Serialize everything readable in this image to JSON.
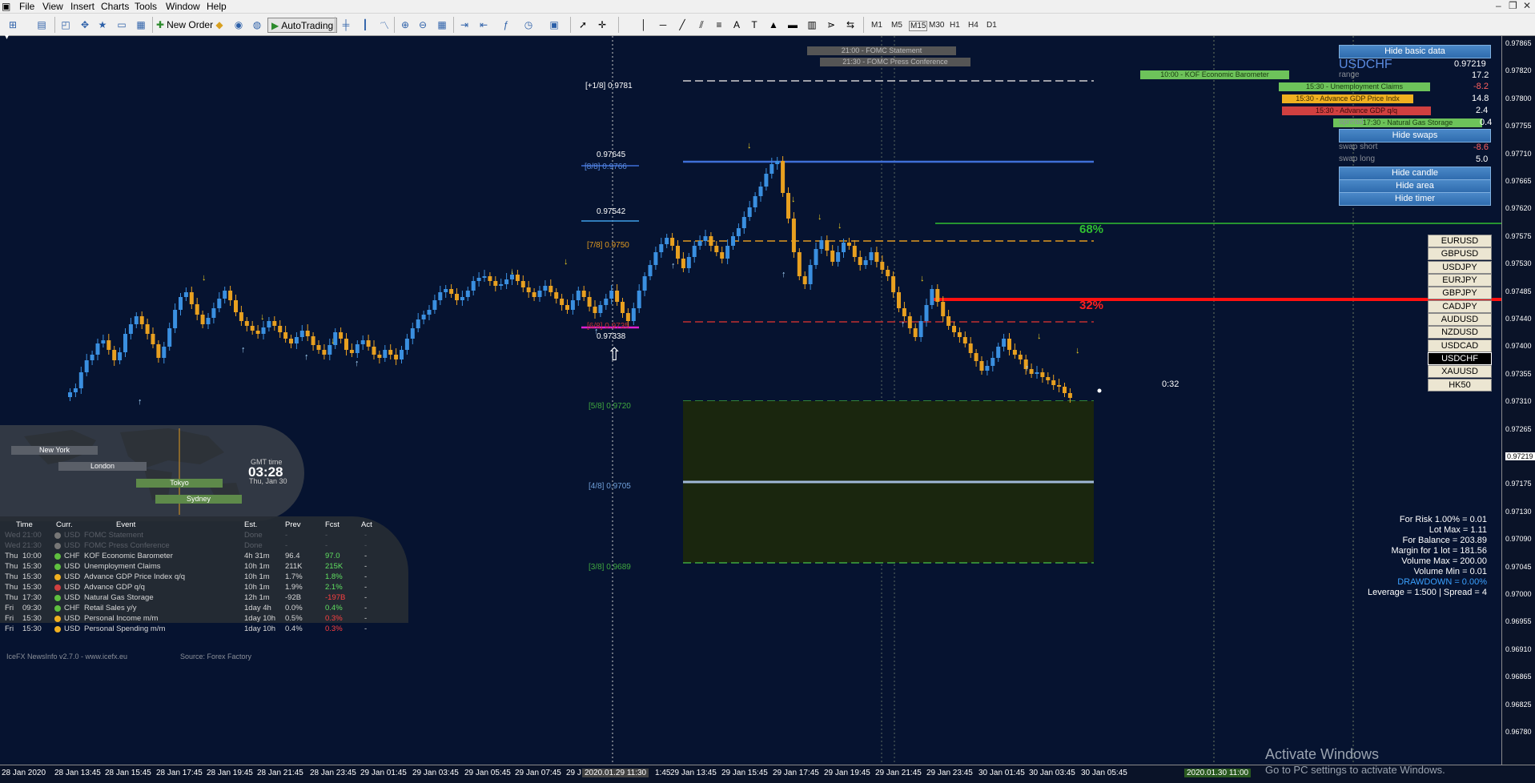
{
  "menu": {
    "items": [
      "File",
      "View",
      "Insert",
      "Charts",
      "Tools",
      "Window",
      "Help"
    ]
  },
  "toolbar": {
    "new_order": "New Order",
    "autotrading": "AutoTrading",
    "timeframes": [
      "M1",
      "M5",
      "M15",
      "M30",
      "H1",
      "H4",
      "D1"
    ]
  },
  "chart": {
    "symbol": "USDCHF",
    "price": "0.97219",
    "range_label": "range",
    "range_value": "17.2",
    "spread_label": "spread",
    "spread_value": "0.4",
    "swap_short_label": "swap short",
    "swap_short_value": "-8.6",
    "swap_long_label": "swap long",
    "swap_long_value": "5.0",
    "buttons": {
      "hide_basic": "Hide basic data",
      "hide_swaps": "Hide swaps",
      "hide_candle": "Hide candle",
      "hide_area": "Hide area",
      "hide_timer": "Hide timer"
    },
    "murrey": {
      "p1_8": "[+1/8]  0.9781",
      "p8_8_label": "[8/8]",
      "p8_8_value": "0.9766",
      "p7_8_label": "[7/8]",
      "p7_8_value": "0.9750",
      "p6_8_label": "[6/8]",
      "p6_8_value": "0.9735",
      "p5_8_label": "[5/8]",
      "p5_8_value": "0.9720",
      "p4_8_label": "[4/8]",
      "p4_8_value": "0.9705",
      "p3_8_label": "[3/8]",
      "p3_8_value": "0.9689"
    },
    "labels": {
      "high1": "0.97645",
      "high2": "0.97542",
      "low": "0.97338",
      "pct68": "68%",
      "pct32": "32%",
      "timer": "0:32"
    },
    "news_bars": [
      "21:00 - FOMC Statement",
      "21:30 - FOMC Press Conference",
      "10:00 - KOF Economic Barometer",
      "15:30 - Unemployment Claims",
      "15:30 - Advance GDP Price Indx",
      "15:30 - Advance GDP q/q",
      "17:30 - Natural Gas Storage"
    ],
    "news_side_values": [
      "-8.2",
      "14.8",
      "2.4"
    ],
    "symbols": [
      "EURUSD",
      "GBPUSD",
      "USDJPY",
      "EURJPY",
      "GBPJPY",
      "CADJPY",
      "AUDUSD",
      "NZDUSD",
      "USDCAD",
      "USDCHF",
      "XAUUSD",
      "HK50"
    ],
    "risk": {
      "risk": "For Risk 1.00% = 0.01",
      "lot_max": "Lot Max = 1.11",
      "balance": "For Balance = 203.89",
      "margin": "Margin for 1 lot = 181.56",
      "vol_max": "Volume Max = 200.00",
      "vol_min": "Volume Min = 0.01",
      "drawdown": "DRAWDOWN =  0.00%",
      "leverage": "Leverage = 1:500 | Spread = 4"
    },
    "price_axis": [
      "0.97865",
      "0.97820",
      "0.97800",
      "0.97755",
      "0.97710",
      "0.97665",
      "0.97620",
      "0.97575",
      "0.97530",
      "0.97485",
      "0.97440",
      "0.97400",
      "0.97355",
      "0.97310",
      "0.97265",
      "0.97219",
      "0.97175",
      "0.97130",
      "0.97090",
      "0.97045",
      "0.97000",
      "0.96955",
      "0.96910",
      "0.96865",
      "0.96825",
      "0.96780"
    ],
    "time_axis": [
      "28 Jan 2020",
      "28 Jan 13:45",
      "28 Jan 15:45",
      "28 Jan 17:45",
      "28 Jan 19:45",
      "28 Jan 21:45",
      "28 Jan 23:45",
      "29 Jan 01:45",
      "29 Jan 03:45",
      "29 Jan 05:45",
      "29 Jan 07:45",
      "29 J",
      "2020.01.29 11:30",
      "1:45",
      "29 Jan 13:45",
      "29 Jan 15:45",
      "29 Jan 17:45",
      "29 Jan 19:45",
      "29 Jan 21:45",
      "29 Jan 23:45",
      "30 Jan 01:45",
      "30 Jan 03:45",
      "30 Jan 05:45",
      "2020.01.30 11:00"
    ]
  },
  "clock": {
    "gmt_label": "GMT time",
    "time": "03:28",
    "date": "Thu, Jan 30",
    "sessions": [
      "New York",
      "London",
      "Tokyo",
      "Sydney"
    ]
  },
  "newsinfo": {
    "headers": [
      "Time",
      "Curr.",
      "Event",
      "Est.",
      "Prev",
      "Fcst",
      "Act"
    ],
    "rows": [
      {
        "day": "Wed",
        "time": "21:00",
        "curr": "USD",
        "event": "FOMC Statement",
        "est": "Done",
        "prev": "-",
        "fcst": "-",
        "act": "-",
        "color": "#777777",
        "dim": true
      },
      {
        "day": "Wed",
        "time": "21:30",
        "curr": "USD",
        "event": "FOMC Press Conference",
        "est": "Done",
        "prev": "-",
        "fcst": "-",
        "act": "-",
        "color": "#777777",
        "dim": true
      },
      {
        "day": "Thu",
        "time": "10:00",
        "curr": "CHF",
        "event": "KOF Economic Barometer",
        "est": "4h 31m",
        "prev": "96.4",
        "fcst": "97.0",
        "act": "-",
        "color": "#5fbf3f",
        "dim": false
      },
      {
        "day": "Thu",
        "time": "15:30",
        "curr": "USD",
        "event": "Unemployment Claims",
        "est": "10h 1m",
        "prev": "211K",
        "fcst": "215K",
        "act": "-",
        "color": "#5fbf3f",
        "dim": false
      },
      {
        "day": "Thu",
        "time": "15:30",
        "curr": "USD",
        "event": "Advance GDP Price Index q/q",
        "est": "10h 1m",
        "prev": "1.7%",
        "fcst": "1.8%",
        "act": "-",
        "color": "#f0b020",
        "dim": false
      },
      {
        "day": "Thu",
        "time": "15:30",
        "curr": "USD",
        "event": "Advance GDP q/q",
        "est": "10h 1m",
        "prev": "1.9%",
        "fcst": "2.1%",
        "act": "-",
        "color": "#d04040",
        "dim": false
      },
      {
        "day": "Thu",
        "time": "17:30",
        "curr": "USD",
        "event": "Natural Gas Storage",
        "est": "12h 1m",
        "prev": "-92B",
        "fcst": "-197B",
        "act": "-",
        "color": "#5fbf3f",
        "dim": false
      },
      {
        "day": "Fri",
        "time": "09:30",
        "curr": "CHF",
        "event": "Retail Sales y/y",
        "est": "1day 4h",
        "prev": "0.0%",
        "fcst": "0.4%",
        "act": "-",
        "color": "#5fbf3f",
        "dim": false
      },
      {
        "day": "Fri",
        "time": "15:30",
        "curr": "USD",
        "event": "Personal Income m/m",
        "est": "1day 10h",
        "prev": "0.5%",
        "fcst": "0.3%",
        "act": "-",
        "color": "#f0b020",
        "dim": false
      },
      {
        "day": "Fri",
        "time": "15:30",
        "curr": "USD",
        "event": "Personal Spending m/m",
        "est": "1day 10h",
        "prev": "0.4%",
        "fcst": "0.3%",
        "act": "-",
        "color": "#f0b020",
        "dim": false
      }
    ],
    "footer_left": "IceFX NewsInfo v2.7.0  -  www.icefx.eu",
    "footer_right": "Source: Forex Factory"
  },
  "watermark": {
    "line1": "Activate Windows",
    "line2": "Go to PC settings to activate Windows."
  }
}
